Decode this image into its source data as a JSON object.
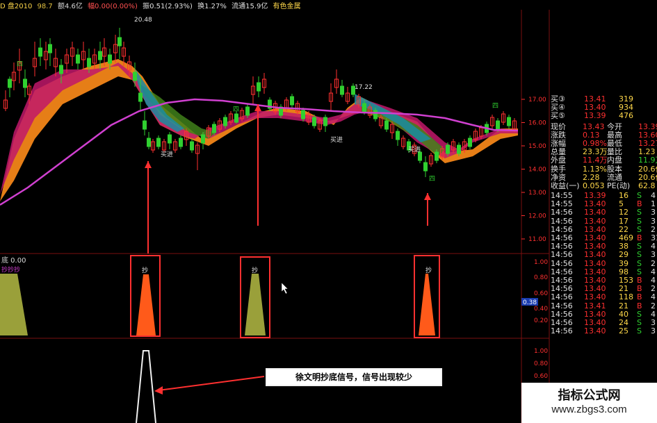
{
  "topbar": {
    "name": "D 盘2010",
    "date": "98.7",
    "vol": "额4.6亿",
    "amp": "幅0.00(0.00%)",
    "hand": "振0.51(2.93%)",
    "turn": "换1.27%",
    "flow": "流通15.9亿",
    "industry": "有色金属"
  },
  "price_labels": {
    "high": "20.48",
    "local_high": "17.22",
    "buy1": "买进",
    "buy2": "买进",
    "buy3": "买进",
    "sig_4": "四",
    "sig_5": "四",
    "sig_6": "四",
    "sig_7": "四"
  },
  "price_axis": [
    "17.00",
    "16.00",
    "15.00",
    "14.00",
    "13.00",
    "12.00",
    "11.00"
  ],
  "ind_axis": [
    "1.00",
    "0.80",
    "0.60",
    "0.40",
    "0.38",
    "0.20"
  ],
  "ind2_axis": [
    "1.00",
    "0.80",
    "0.60",
    "0.40",
    "0.20"
  ],
  "ind_panel": {
    "title": "底 0.00",
    "subtitle": "抄抄抄",
    "box1": "抄",
    "box2": "抄",
    "box3": "抄"
  },
  "quotes": [
    {
      "label": "买③",
      "price": "13.41",
      "vol": "319"
    },
    {
      "label": "买④",
      "price": "13.40",
      "vol": "934"
    },
    {
      "label": "买⑤",
      "price": "13.39",
      "vol": "476"
    }
  ],
  "stats": [
    {
      "k1": "现价",
      "v1": "13.43",
      "k2": "今开",
      "v2": "13.39"
    },
    {
      "k1": "涨跌",
      "v1": "0.13",
      "k2": "最高",
      "v2": "13.60"
    },
    {
      "k1": "涨幅",
      "v1": "0.98%",
      "k2": "最低",
      "v2": "13.27"
    },
    {
      "k1": "总量",
      "v1": "23.3万",
      "k2": "量比",
      "v2": "1.23"
    },
    {
      "k1": "外盘",
      "v1": "11.4万",
      "k2": "内盘",
      "v2": "11.9万"
    },
    {
      "k1": "换手",
      "v1": "1.13%",
      "k2": "股本",
      "v2": "20.6亿"
    },
    {
      "k1": "净资",
      "v1": "2.28",
      "k2": "流通",
      "v2": "20.6亿"
    },
    {
      "k1": "收益(一)",
      "v1": "0.053",
      "k2": "PE(动)",
      "v2": "62.8"
    }
  ],
  "trades": [
    {
      "t": "14:55",
      "p": "13.39",
      "v": "16",
      "d": "S",
      "n": "4"
    },
    {
      "t": "14:55",
      "p": "13.40",
      "v": "5",
      "d": "B",
      "n": "1"
    },
    {
      "t": "14:56",
      "p": "13.40",
      "v": "12",
      "d": "S",
      "n": "3"
    },
    {
      "t": "14:56",
      "p": "13.40",
      "v": "17",
      "d": "S",
      "n": "3"
    },
    {
      "t": "14:56",
      "p": "13.40",
      "v": "22",
      "d": "S",
      "n": "2"
    },
    {
      "t": "14:56",
      "p": "13.40",
      "v": "469",
      "d": "B",
      "n": "31"
    },
    {
      "t": "14:56",
      "p": "13.40",
      "v": "38",
      "d": "S",
      "n": "4"
    },
    {
      "t": "14:56",
      "p": "13.40",
      "v": "29",
      "d": "S",
      "n": "3"
    },
    {
      "t": "14:56",
      "p": "13.40",
      "v": "39",
      "d": "S",
      "n": "2"
    },
    {
      "t": "14:56",
      "p": "13.40",
      "v": "98",
      "d": "S",
      "n": "4"
    },
    {
      "t": "14:56",
      "p": "13.40",
      "v": "153",
      "d": "B",
      "n": "4"
    },
    {
      "t": "14:56",
      "p": "13.40",
      "v": "21",
      "d": "B",
      "n": "2"
    },
    {
      "t": "14:56",
      "p": "13.40",
      "v": "118",
      "d": "B",
      "n": "4"
    },
    {
      "t": "14:56",
      "p": "13.41",
      "v": "21",
      "d": "B",
      "n": "2"
    },
    {
      "t": "14:56",
      "p": "13.40",
      "v": "40",
      "d": "S",
      "n": "4"
    },
    {
      "t": "14:56",
      "p": "13.40",
      "v": "24",
      "d": "S",
      "n": "3"
    },
    {
      "t": "14:56",
      "p": "13.40",
      "v": "25",
      "d": "S",
      "n": "3"
    }
  ],
  "callout": "徐文明抄底信号，信号出现较少",
  "watermark": {
    "line1": "指标公式网",
    "line2": "www.zbgs3.com"
  },
  "colors": {
    "up": "#ff3030",
    "down": "#30d030",
    "ma": "#d040d0",
    "price_box": "#ff3030"
  }
}
